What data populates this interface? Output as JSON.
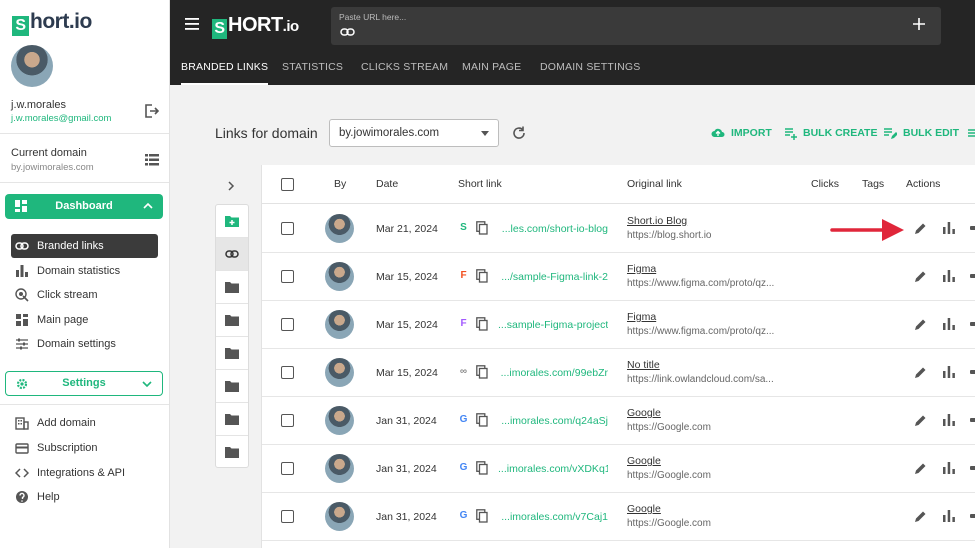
{
  "sidebar": {
    "logo": "hort.io",
    "logo_mark": "S",
    "user_name": "j.w.morales",
    "user_email": "j.w.morales@gmail.com",
    "current_domain_label": "Current domain",
    "current_domain_value": "by.jowimorales.com",
    "dashboard_label": "Dashboard",
    "nav": [
      {
        "label": "Branded links",
        "icon": "link-icon"
      },
      {
        "label": "Domain statistics",
        "icon": "bar-chart-icon"
      },
      {
        "label": "Click stream",
        "icon": "click-icon"
      },
      {
        "label": "Main page",
        "icon": "layout-icon"
      },
      {
        "label": "Domain settings",
        "icon": "sliders-icon"
      }
    ],
    "settings_label": "Settings",
    "bottom_nav": [
      {
        "label": "Add domain",
        "icon": "building-icon"
      },
      {
        "label": "Subscription",
        "icon": "card-icon"
      },
      {
        "label": "Integrations & API",
        "icon": "code-icon"
      },
      {
        "label": "Help",
        "icon": "help-icon"
      }
    ]
  },
  "topbar": {
    "logo_mark": "S",
    "logo_text": "HORT",
    "logo_suffix": ".io",
    "url_placeholder": "Paste URL here...",
    "tabs": [
      "BRANDED LINKS",
      "STATISTICS",
      "CLICKS STREAM",
      "MAIN PAGE",
      "DOMAIN SETTINGS"
    ],
    "active_tab": 0
  },
  "main": {
    "title": "Links for domain",
    "domain_select": "by.jowimorales.com",
    "actions": [
      "IMPORT",
      "BULK CREATE",
      "BULK EDIT"
    ]
  },
  "table": {
    "headers": {
      "by": "By",
      "date": "Date",
      "short": "Short link",
      "original": "Original link",
      "clicks": "Clicks",
      "tags": "Tags",
      "actions": "Actions"
    },
    "rows": [
      {
        "date": "Mar 21, 2024",
        "short": "...les.com/short-io-blog",
        "title": "Short.io Blog",
        "url": "https://blog.short.io",
        "favicon": "S",
        "favicon_color": "#1fb77d"
      },
      {
        "date": "Mar 15, 2024",
        "short": ".../sample-Figma-link-2",
        "title": "Figma",
        "url": "https://www.figma.com/proto/qz...",
        "favicon": "F",
        "favicon_color": "#f24e1e"
      },
      {
        "date": "Mar 15, 2024",
        "short": "...sample-Figma-project",
        "title": "Figma",
        "url": "https://www.figma.com/proto/qz...",
        "favicon": "F",
        "favicon_color": "#a259ff"
      },
      {
        "date": "Mar 15, 2024",
        "short": "...imorales.com/99ebZr",
        "title": "No title",
        "url": "https://link.owlandcloud.com/sa...",
        "favicon": "∞",
        "favicon_color": "#888888"
      },
      {
        "date": "Jan 31, 2024",
        "short": "...imorales.com/q24aSj",
        "title": "Google",
        "url": "https://Google.com",
        "favicon": "G",
        "favicon_color": "#4285f4"
      },
      {
        "date": "Jan 31, 2024",
        "short": "...imorales.com/vXDKq1",
        "title": "Google",
        "url": "https://Google.com",
        "favicon": "G",
        "favicon_color": "#4285f4"
      },
      {
        "date": "Jan 31, 2024",
        "short": "...imorales.com/v7Caj1",
        "title": "Google",
        "url": "https://Google.com",
        "favicon": "G",
        "favicon_color": "#4285f4"
      }
    ]
  },
  "colors": {
    "accent": "#1fb77d",
    "topbar": "#252525",
    "arrow": "#e0263a"
  }
}
